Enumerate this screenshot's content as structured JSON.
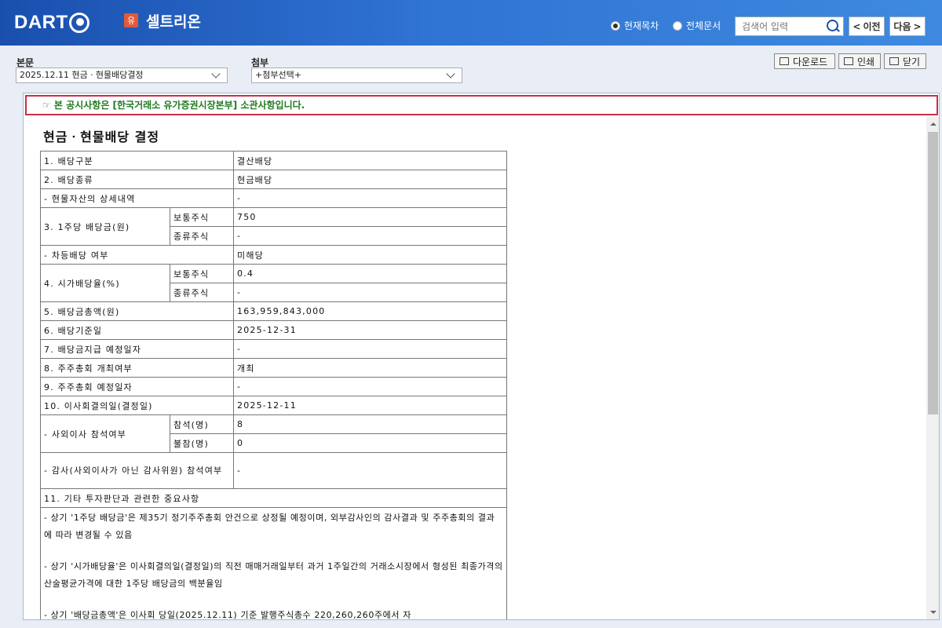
{
  "header": {
    "logo_text": "DART",
    "market_badge": "유",
    "company_name": "셀트리온",
    "scope_options": [
      {
        "label": "현재목차",
        "checked": true
      },
      {
        "label": "전체문서",
        "checked": false
      }
    ],
    "search_placeholder": "검색어 입력",
    "prev_label": "이전",
    "next_label": "다음"
  },
  "toolbar": {
    "main_label": "본문",
    "main_select": "2025.12.11  현금ㆍ현물배당결정",
    "attach_label": "첨부",
    "attach_select": "+첨부선택+",
    "download_label": "다운로드",
    "print_label": "인쇄",
    "close_label": "닫기"
  },
  "document": {
    "notice": "☞ 본 공시사항은 [한국거래소 유가증권시장본부] 소관사항입니다.",
    "title": "현금ㆍ현물배당 결정",
    "rows": {
      "r1_label": "1. 배당구분",
      "r1_value": "결산배당",
      "r2_label": "2. 배당종류",
      "r2_value": "현금배당",
      "r2a_label": "- 현물자산의 상세내역",
      "r2a_value": "-",
      "r3_label": "3. 1주당 배당금(원)",
      "r3_sub1": "보통주식",
      "r3_val1": "750",
      "r3_sub2": "종류주식",
      "r3_val2": "-",
      "r3a_label": "- 차등배당 여부",
      "r3a_value": "미해당",
      "r4_label": "4. 시가배당율(%)",
      "r4_sub1": "보통주식",
      "r4_val1": "0.4",
      "r4_sub2": "종류주식",
      "r4_val2": "-",
      "r5_label": "5. 배당금총액(원)",
      "r5_value": "163,959,843,000",
      "r6_label": "6. 배당기준일",
      "r6_value": "2025-12-31",
      "r7_label": "7. 배당금지급 예정일자",
      "r7_value": "-",
      "r8_label": "8. 주주총회 개최여부",
      "r8_value": "개최",
      "r9_label": "9. 주주총회 예정일자",
      "r9_value": "-",
      "r10_label": "10. 이사회결의일(결정일)",
      "r10_value": "2025-12-11",
      "r10a_label": "- 사외이사 참석여부",
      "r10a_sub1": "참석(명)",
      "r10a_val1": "8",
      "r10a_sub2": "불참(명)",
      "r10a_val2": "0",
      "r10b_label": "- 감사(사외이사가 아닌 감사위원) 참석여부",
      "r10b_value": "-",
      "r11_label": "11. 기타 투자판단과 관련한 중요사항"
    },
    "notes": [
      "- 상기 '1주당 배당금'은 제35기 정기주주총회 안건으로 상정될 예정이며, 외부감사인의 감사결과 및 주주총회의 결과에 따라 변경될 수 있음",
      "- 상기 '시가배당율'은 이사회결의일(결정일)의 직전 매매거래일부터 과거 1주일간의 거래소시장에서 형성된 최종가격의 산술평균가격에 대한 1주당 배당금의 백분율임",
      "- 상기 '배당금총액'은 이사회 당일(2025.12.11) 기준 발행주식총수 220,260,260주에서 자"
    ]
  }
}
